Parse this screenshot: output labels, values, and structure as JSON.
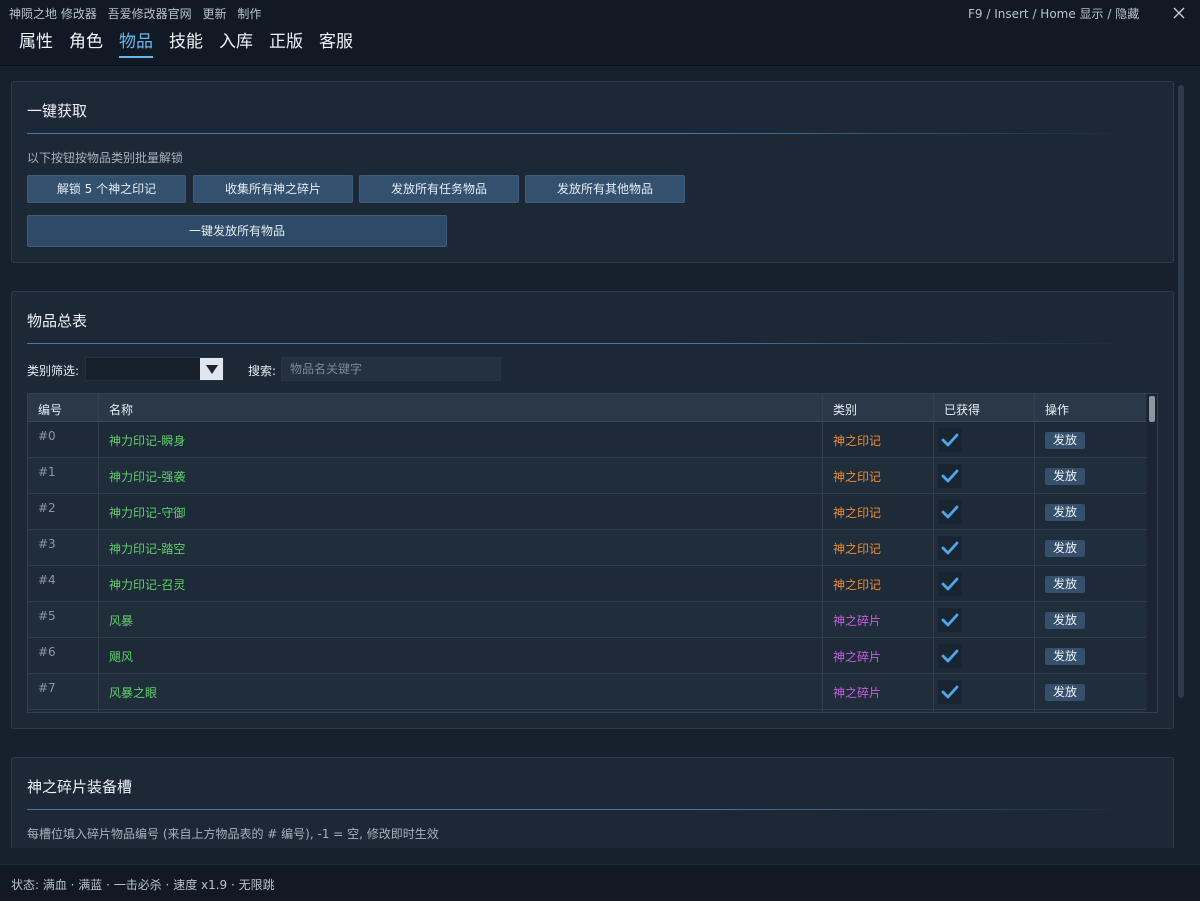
{
  "titlebar": {
    "app_name": "神陨之地 修改器",
    "links": [
      "吾爱修改器官网",
      "更新",
      "制作"
    ],
    "hotkey": "F9 / Insert / Home  显示 / 隐藏"
  },
  "tabs": [
    {
      "label": "属性",
      "active": false
    },
    {
      "label": "角色",
      "active": false
    },
    {
      "label": "物品",
      "active": true
    },
    {
      "label": "技能",
      "active": false
    },
    {
      "label": "入库",
      "active": false
    },
    {
      "label": "正版",
      "active": false
    },
    {
      "label": "客服",
      "active": false
    }
  ],
  "quick_panel": {
    "title": "一键获取",
    "hint": "以下按钮按物品类别批量解锁",
    "buttons": [
      "解锁 5 个神之印记",
      "收集所有神之碎片",
      "发放所有任务物品",
      "发放所有其他物品"
    ],
    "wide_button": "一键发放所有物品"
  },
  "items_panel": {
    "title": "物品总表",
    "filter_label": "类别筛选:",
    "filter_value": "",
    "search_label": "搜索:",
    "search_placeholder": "物品名关键字",
    "columns": [
      "编号",
      "名称",
      "类别",
      "已获得",
      "操作"
    ],
    "rows": [
      {
        "id": "#0",
        "name": "神力印记-瞬身",
        "category": "神之印记",
        "obtained": true,
        "action": "发放"
      },
      {
        "id": "#1",
        "name": "神力印记-强袭",
        "category": "神之印记",
        "obtained": true,
        "action": "发放"
      },
      {
        "id": "#2",
        "name": "神力印记-守御",
        "category": "神之印记",
        "obtained": true,
        "action": "发放"
      },
      {
        "id": "#3",
        "name": "神力印记-踏空",
        "category": "神之印记",
        "obtained": true,
        "action": "发放"
      },
      {
        "id": "#4",
        "name": "神力印记-召灵",
        "category": "神之印记",
        "obtained": true,
        "action": "发放"
      },
      {
        "id": "#5",
        "name": "风暴",
        "category": "神之碎片",
        "obtained": true,
        "action": "发放"
      },
      {
        "id": "#6",
        "name": "飓风",
        "category": "神之碎片",
        "obtained": true,
        "action": "发放"
      },
      {
        "id": "#7",
        "name": "风暴之眼",
        "category": "神之碎片",
        "obtained": true,
        "action": "发放"
      }
    ]
  },
  "slots_panel": {
    "title": "神之碎片装备槽",
    "hint": "每槽位填入碎片物品编号 (来自上方物品表的 # 编号), -1 = 空, 修改即时生效"
  },
  "status": "状态: 满血 · 满蓝 · 一击必杀 · 速度 x1.9 · 无限跳",
  "colors": {
    "accent": "#6cb6f0",
    "name_green": "#5fcf6b",
    "category_sigil": "#f08d2e",
    "category_shard": "#c55fe0",
    "check": "#4fa8e8"
  }
}
